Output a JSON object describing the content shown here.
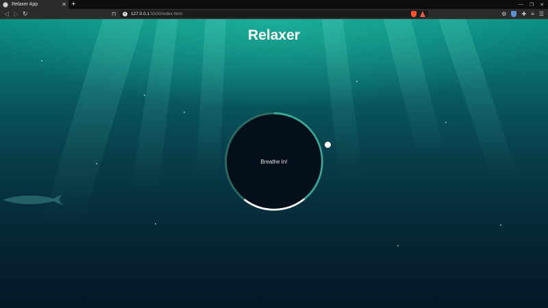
{
  "browser": {
    "tab": {
      "title": "Relaxer App",
      "favicon": "globe-icon"
    },
    "url": {
      "host": "127.0.0.1",
      "path": ":5500/index.html"
    }
  },
  "app": {
    "title": "Relaxer",
    "breath_text": "Breathe In!"
  },
  "colors": {
    "ring_accent": "#3aa896",
    "ring_dim": "#2a6a62",
    "ring_white": "#ffffff",
    "circle_fill": "#040f1c"
  }
}
